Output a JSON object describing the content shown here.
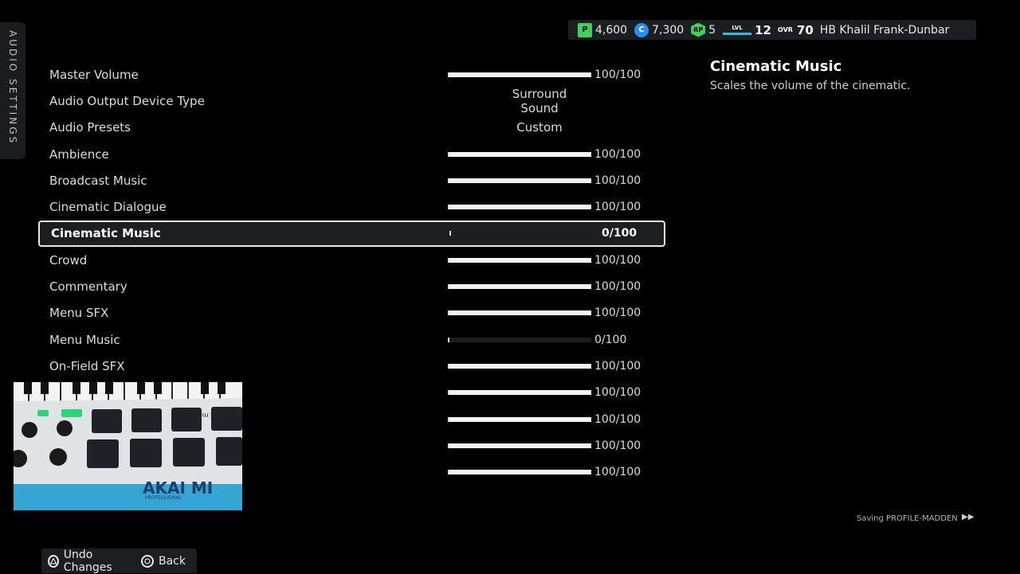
{
  "sidebar": {
    "label": "AUDIO SETTINGS"
  },
  "currency": {
    "points": "4,600",
    "coins": "7,300",
    "xp": "5",
    "xp_badge": "RP",
    "points_badge": "P",
    "coins_badge": "C"
  },
  "player": {
    "level_label": "LVL",
    "level": "12",
    "ovr_label": "OVR",
    "ovr": "70",
    "name": "HB Khalil Frank-Dunbar"
  },
  "settings": [
    {
      "label": "Master Volume",
      "kind": "slider",
      "value": 100,
      "display": "100/100"
    },
    {
      "label": "Audio Output Device Type",
      "kind": "text",
      "display": "Surround Sound"
    },
    {
      "label": "Audio Presets",
      "kind": "text",
      "display": "Custom"
    },
    {
      "label": "Ambience",
      "kind": "slider",
      "value": 100,
      "display": "100/100"
    },
    {
      "label": "Broadcast Music",
      "kind": "slider",
      "value": 100,
      "display": "100/100"
    },
    {
      "label": "Cinematic Dialogue",
      "kind": "slider",
      "value": 100,
      "display": "100/100"
    },
    {
      "label": "Cinematic Music",
      "kind": "slider",
      "value": 0,
      "display": "0/100",
      "selected": true
    },
    {
      "label": "Crowd",
      "kind": "slider",
      "value": 100,
      "display": "100/100"
    },
    {
      "label": "Commentary",
      "kind": "slider",
      "value": 100,
      "display": "100/100"
    },
    {
      "label": "Menu SFX",
      "kind": "slider",
      "value": 100,
      "display": "100/100"
    },
    {
      "label": "Menu Music",
      "kind": "slider",
      "value": 0,
      "display": "0/100"
    },
    {
      "label": "On-Field SFX",
      "kind": "slider",
      "value": 100,
      "display": "100/100"
    },
    {
      "label": "",
      "kind": "slider",
      "value": 100,
      "display": "100/100"
    },
    {
      "label": "",
      "kind": "slider",
      "value": 100,
      "display": "100/100"
    },
    {
      "label": "",
      "kind": "slider",
      "value": 100,
      "display": "100/100"
    },
    {
      "label": "",
      "kind": "slider",
      "value": 100,
      "display": "100/100"
    }
  ],
  "description": {
    "title": "Cinematic Music",
    "body": "Scales the volume of the cinematic."
  },
  "status": {
    "saving": "Saving PROFILE-MADDEN",
    "icon": "fast-forward-icon"
  },
  "footer": {
    "undo": "Undo Changes",
    "back": "Back"
  },
  "overlay": {
    "brand": "AKAI MI",
    "model": "MPK mini",
    "sub": "PROFESSIONAL"
  },
  "colors": {
    "points": "#3fd15b",
    "coins": "#2d8cf0",
    "level_bar": "#2fbde0",
    "selection_border": "#e8e8e8"
  }
}
